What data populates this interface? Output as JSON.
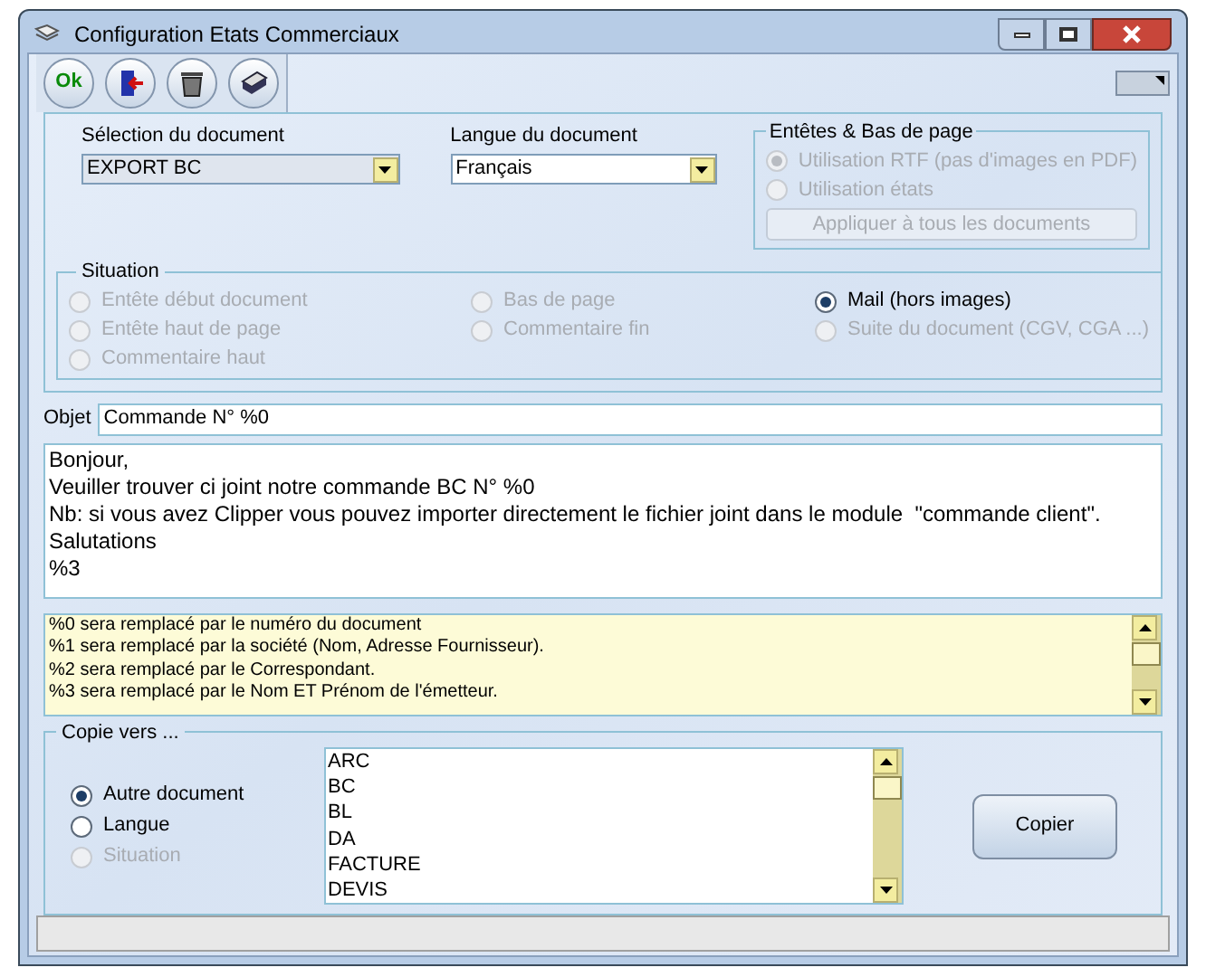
{
  "window": {
    "title": "Configuration Etats Commerciaux"
  },
  "toolbar": [
    {
      "kind": "ok",
      "label": "Ok"
    },
    {
      "kind": "exit"
    },
    {
      "kind": "trash"
    },
    {
      "kind": "print"
    }
  ],
  "document_select": {
    "label": "Sélection du document",
    "value": "EXPORT BC"
  },
  "language_select": {
    "label": "Langue du document",
    "value": "Français"
  },
  "headers_group": {
    "title": "Entêtes & Bas de page",
    "options": [
      {
        "label": "Utilisation RTF (pas d'images en PDF)",
        "selected": true,
        "disabled": true
      },
      {
        "label": "Utilisation états",
        "selected": false,
        "disabled": true
      }
    ],
    "apply_button": {
      "label": "Appliquer à tous les documents",
      "disabled": true
    }
  },
  "situation": {
    "title": "Situation",
    "options": [
      {
        "label": "Entête début document",
        "selected": false,
        "disabled": true
      },
      {
        "label": "Entête haut de page",
        "selected": false,
        "disabled": true
      },
      {
        "label": "Commentaire haut",
        "selected": false,
        "disabled": true
      },
      {
        "label": "Bas de page",
        "selected": false,
        "disabled": true
      },
      {
        "label": "Commentaire fin",
        "selected": false,
        "disabled": true
      },
      {
        "label": "Mail (hors images)",
        "selected": true,
        "disabled": false
      },
      {
        "label": "Suite du document (CGV, CGA ...)",
        "selected": false,
        "disabled": true
      }
    ]
  },
  "subject": {
    "label": "Objet",
    "value": "Commande N° %0"
  },
  "body_lines": [
    "Bonjour,",
    "Veuiller trouver ci joint notre commande BC N° %0",
    "Nb: si vous avez Clipper vous pouvez importer directement le fichier joint dans le module  \"commande client\".",
    "Salutations",
    "%3"
  ],
  "help_lines": [
    "%0 sera remplacé par le numéro du document",
    "%1 sera remplacé par la société (Nom, Adresse Fournisseur).",
    "%2 sera remplacé par le Correspondant.",
    "%3 sera remplacé par le Nom ET Prénom de l'émetteur."
  ],
  "copy_group": {
    "title": "Copie vers ...",
    "options": [
      {
        "label": "Autre document",
        "selected": true,
        "disabled": false
      },
      {
        "label": "Langue",
        "selected": false,
        "disabled": false
      },
      {
        "label": "Situation",
        "selected": false,
        "disabled": true
      }
    ],
    "list": [
      "ARC",
      "BC",
      "BL",
      "DA",
      "FACTURE",
      "DEVIS"
    ],
    "copy_button": {
      "label": "Copier"
    }
  }
}
